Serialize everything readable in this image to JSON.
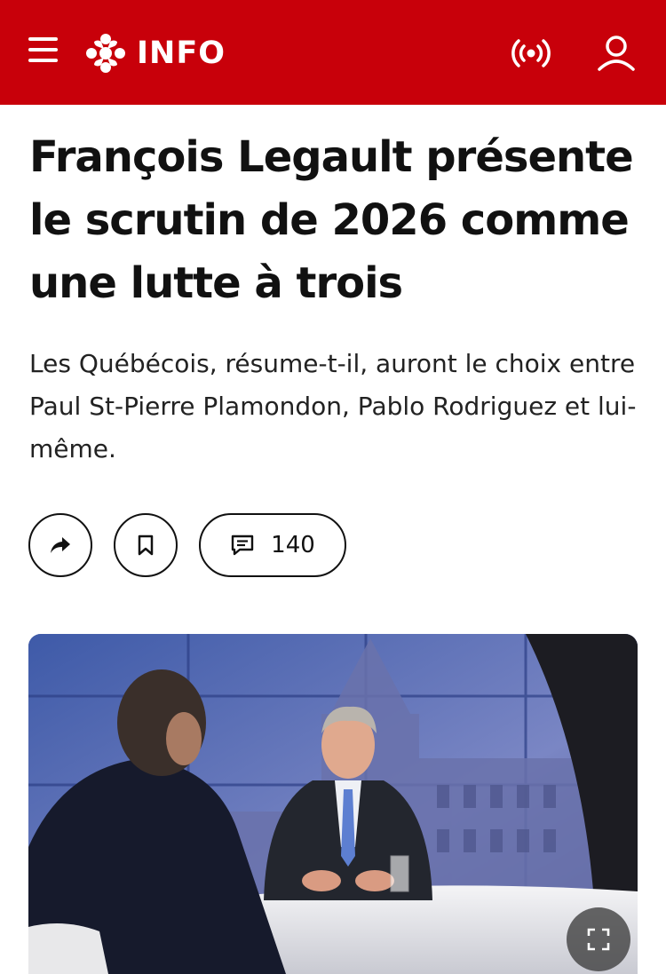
{
  "header": {
    "brand": "INFO",
    "icons": {
      "menu": "hamburger-menu-icon",
      "logo": "cbc-gem-logo",
      "live": "live-broadcast-icon",
      "account": "user-account-icon"
    },
    "background_color": "#c8000a"
  },
  "article": {
    "headline": "François Legault présente le scrutin de 2026 comme une lutte à trois",
    "summary": "Les Québécois, résume-t-il, auront le choix entre Paul St-Pierre Plamondon, Pablo Rodriguez et lui-même."
  },
  "actions": {
    "share_icon": "share-arrow-icon",
    "bookmark_icon": "bookmark-icon",
    "comments_icon": "comment-icon",
    "comments_count": "140"
  },
  "photo": {
    "expand_icon": "expand-fullscreen-icon"
  }
}
